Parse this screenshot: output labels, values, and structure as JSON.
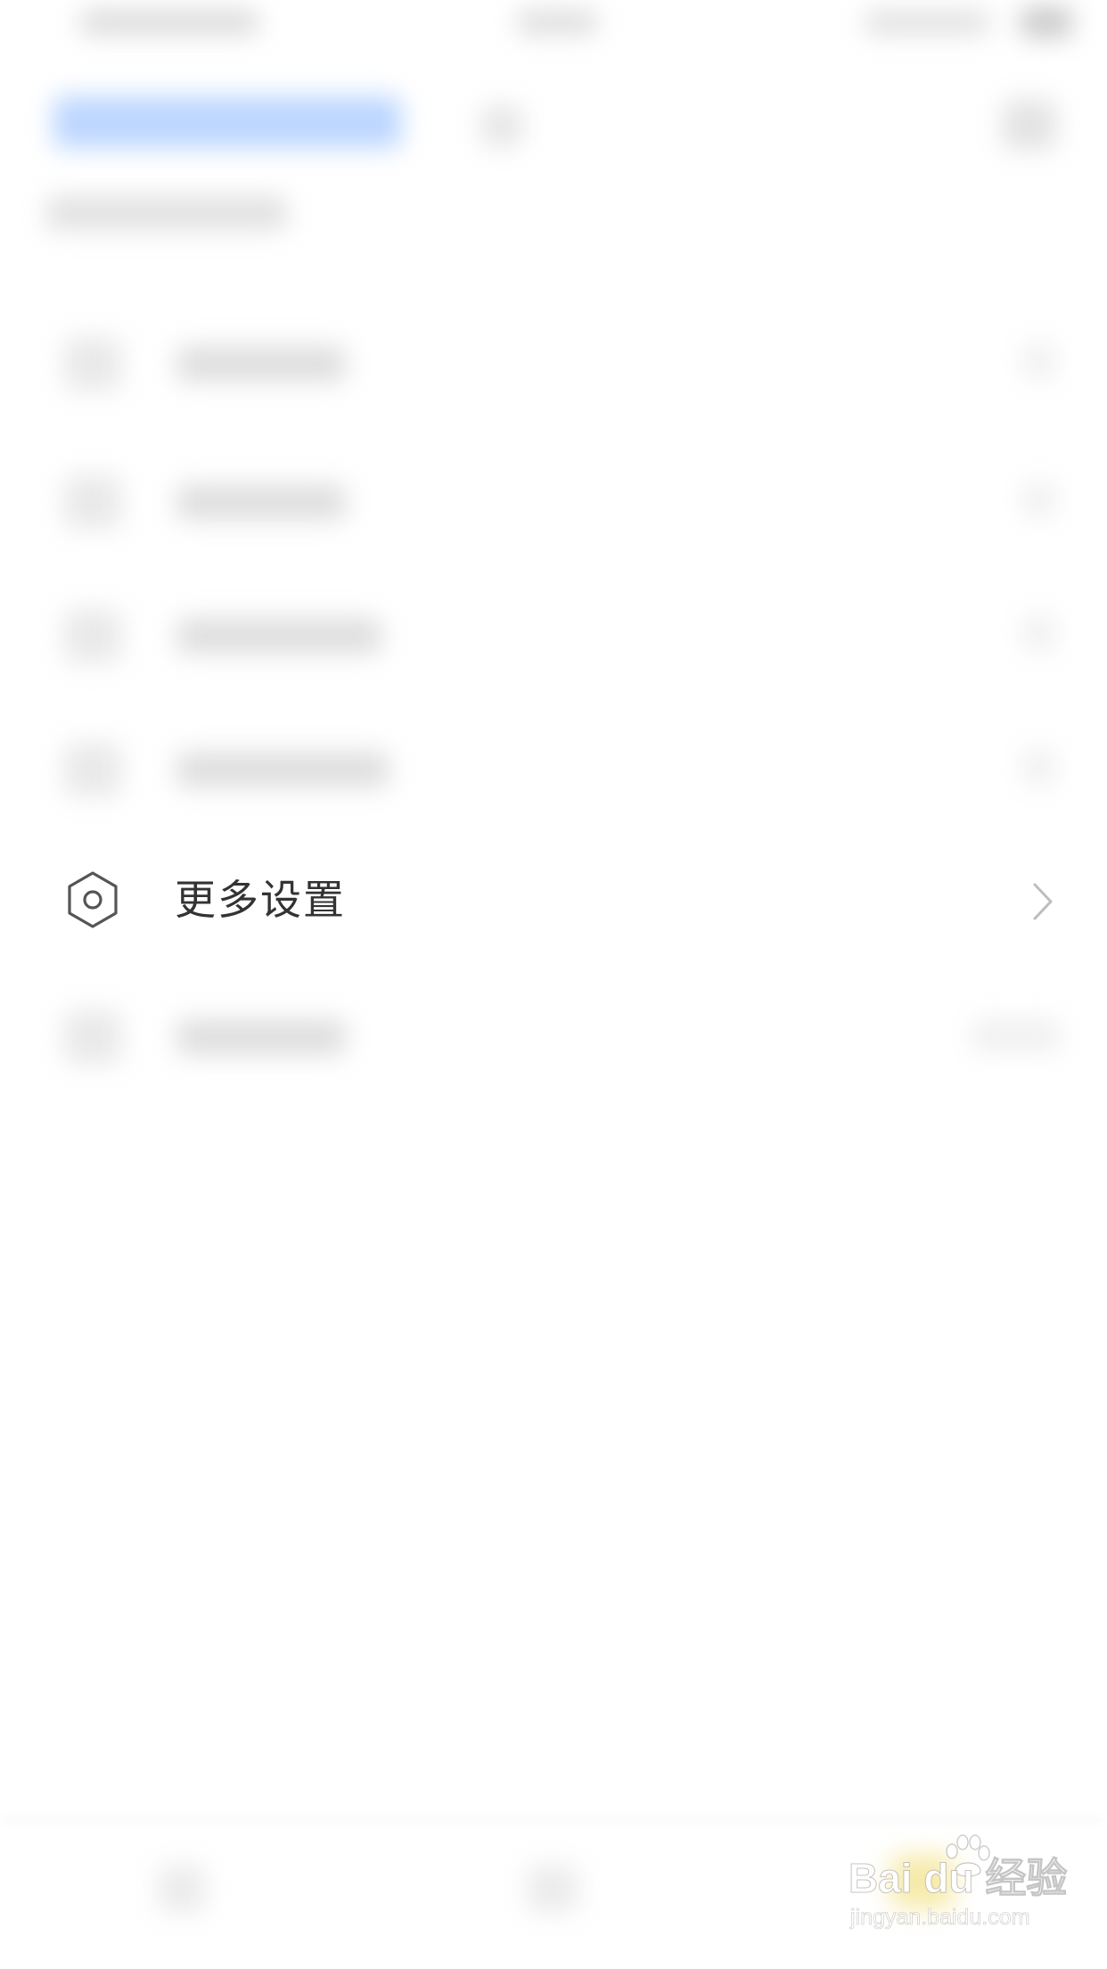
{
  "settings_list": {
    "more_settings": {
      "label": "更多设置",
      "icon": "hexagon-settings-icon",
      "trailing_icon": "chevron-right-icon"
    }
  },
  "watermark": {
    "brand": "Bai du 经验",
    "url": "jingyan.baidu.com"
  },
  "colors": {
    "accent_blue": "#9cc3ff",
    "text": "#333333",
    "icon_stroke": "#555555",
    "chevron": "#bdbdbd"
  }
}
